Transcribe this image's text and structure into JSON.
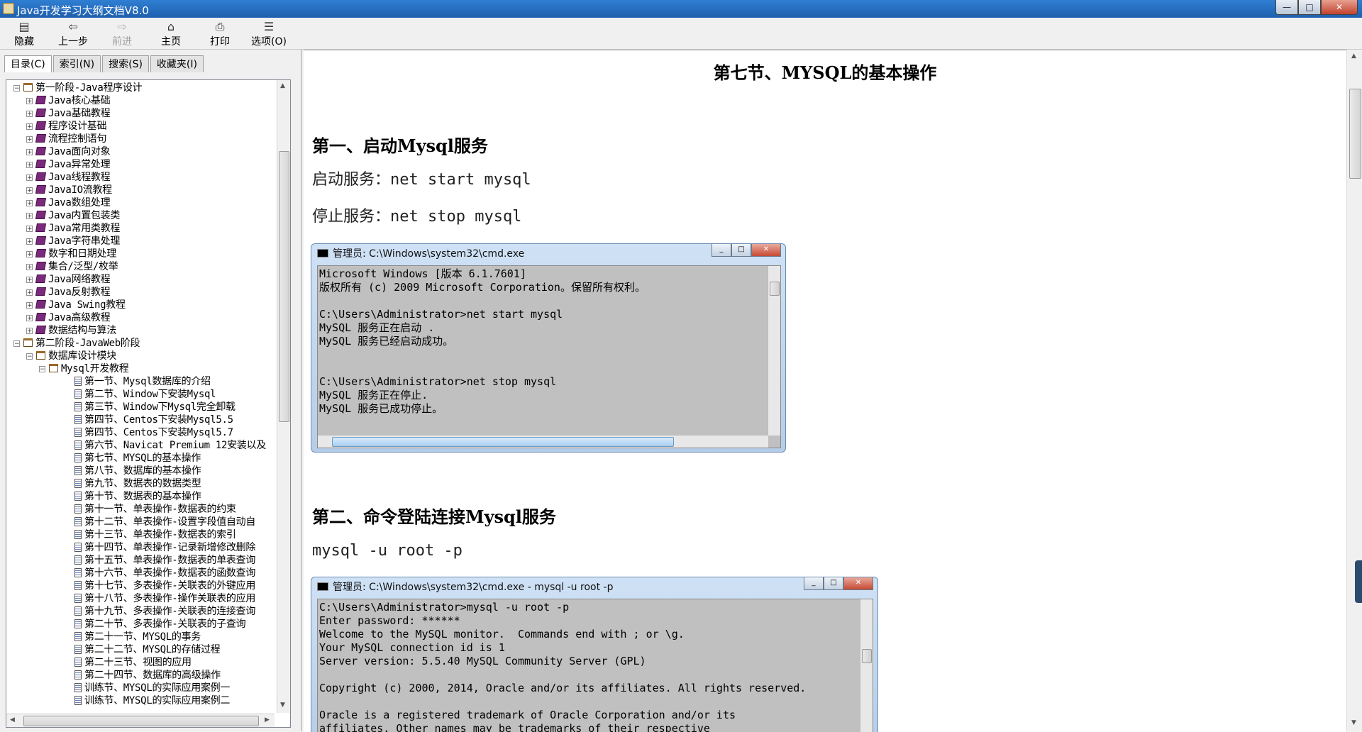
{
  "window": {
    "title": "Java开发学习大纲文档V8.0",
    "min": "—",
    "max": "□",
    "close": "✕"
  },
  "toolbar": [
    {
      "label": "隐藏",
      "icon": "hide-icon",
      "glyph": "▤"
    },
    {
      "label": "上一步",
      "icon": "back-icon",
      "glyph": "⇦"
    },
    {
      "label": "前进",
      "icon": "forward-icon",
      "glyph": "⇨"
    },
    {
      "label": "主页",
      "icon": "home-icon",
      "glyph": "⌂"
    },
    {
      "label": "打印",
      "icon": "print-icon",
      "glyph": "⎙"
    },
    {
      "label": "选项(O)",
      "icon": "options-icon",
      "glyph": "☰"
    }
  ],
  "tabs": [
    "目录(C)",
    "索引(N)",
    "搜索(S)",
    "收藏夹(I)"
  ],
  "tree": [
    {
      "level": 0,
      "type": "book-open",
      "exp": "−",
      "label": "第一阶段-Java程序设计"
    },
    {
      "level": 1,
      "type": "book",
      "exp": "+",
      "label": "Java核心基础"
    },
    {
      "level": 1,
      "type": "book",
      "exp": "+",
      "label": "Java基础教程"
    },
    {
      "level": 1,
      "type": "book",
      "exp": "+",
      "label": "程序设计基础"
    },
    {
      "level": 1,
      "type": "book",
      "exp": "+",
      "label": "流程控制语句"
    },
    {
      "level": 1,
      "type": "book",
      "exp": "+",
      "label": "Java面向对象"
    },
    {
      "level": 1,
      "type": "book",
      "exp": "+",
      "label": "Java异常处理"
    },
    {
      "level": 1,
      "type": "book",
      "exp": "+",
      "label": "Java线程教程"
    },
    {
      "level": 1,
      "type": "book",
      "exp": "+",
      "label": "JavaIO流教程"
    },
    {
      "level": 1,
      "type": "book",
      "exp": "+",
      "label": "Java数组处理"
    },
    {
      "level": 1,
      "type": "book",
      "exp": "+",
      "label": "Java内置包装类"
    },
    {
      "level": 1,
      "type": "book",
      "exp": "+",
      "label": "Java常用类教程"
    },
    {
      "level": 1,
      "type": "book",
      "exp": "+",
      "label": "Java字符串处理"
    },
    {
      "level": 1,
      "type": "book",
      "exp": "+",
      "label": "数字和日期处理"
    },
    {
      "level": 1,
      "type": "book",
      "exp": "+",
      "label": "集合/泛型/枚举"
    },
    {
      "level": 1,
      "type": "book",
      "exp": "+",
      "label": "Java网络教程"
    },
    {
      "level": 1,
      "type": "book",
      "exp": "+",
      "label": "Java反射教程"
    },
    {
      "level": 1,
      "type": "book",
      "exp": "+",
      "label": "Java Swing教程"
    },
    {
      "level": 1,
      "type": "book",
      "exp": "+",
      "label": "Java高级教程"
    },
    {
      "level": 1,
      "type": "book",
      "exp": "+",
      "label": "数据结构与算法"
    },
    {
      "level": 0,
      "type": "book-open",
      "exp": "−",
      "label": "第二阶段-JavaWeb阶段"
    },
    {
      "level": 1,
      "type": "book-open",
      "exp": "−",
      "label": "数据库设计模块"
    },
    {
      "level": 2,
      "type": "book-open",
      "exp": "−",
      "label": "Mysql开发教程"
    },
    {
      "level": 3,
      "type": "page",
      "label": "第一节、Mysql数据库的介绍"
    },
    {
      "level": 3,
      "type": "page",
      "label": "第二节、Window下安装Mysql"
    },
    {
      "level": 3,
      "type": "page",
      "label": "第三节、Window下Mysql完全卸载"
    },
    {
      "level": 3,
      "type": "page",
      "label": "第四节、Centos下安装Mysql5.5"
    },
    {
      "level": 3,
      "type": "page",
      "label": "第四节、Centos下安装Mysql5.7"
    },
    {
      "level": 3,
      "type": "page",
      "label": "第六节、Navicat Premium 12安装以及"
    },
    {
      "level": 3,
      "type": "page",
      "label": "第七节、MYSQL的基本操作"
    },
    {
      "level": 3,
      "type": "page",
      "label": "第八节、数据库的基本操作"
    },
    {
      "level": 3,
      "type": "page",
      "label": "第九节、数据表的数据类型"
    },
    {
      "level": 3,
      "type": "page",
      "label": "第十节、数据表的基本操作"
    },
    {
      "level": 3,
      "type": "page",
      "label": "第十一节、单表操作-数据表的约束"
    },
    {
      "level": 3,
      "type": "page",
      "label": "第十二节、单表操作-设置字段值自动自"
    },
    {
      "level": 3,
      "type": "page",
      "label": "第十三节、单表操作-数据表的索引"
    },
    {
      "level": 3,
      "type": "page",
      "label": "第十四节、单表操作-记录新增修改删除"
    },
    {
      "level": 3,
      "type": "page",
      "label": "第十五节、单表操作-数据表的单表查询"
    },
    {
      "level": 3,
      "type": "page",
      "label": "第十六节、单表操作-数据表的函数查询"
    },
    {
      "level": 3,
      "type": "page",
      "label": "第十七节、多表操作-关联表的外键应用"
    },
    {
      "level": 3,
      "type": "page",
      "label": "第十八节、多表操作-操作关联表的应用"
    },
    {
      "level": 3,
      "type": "page",
      "label": "第十九节、多表操作-关联表的连接查询"
    },
    {
      "level": 3,
      "type": "page",
      "label": "第二十节、多表操作-关联表的子查询"
    },
    {
      "level": 3,
      "type": "page",
      "label": "第二十一节、MYSQL的事务"
    },
    {
      "level": 3,
      "type": "page",
      "label": "第二十二节、MYSQL的存储过程"
    },
    {
      "level": 3,
      "type": "page",
      "label": "第二十三节、视图的应用"
    },
    {
      "level": 3,
      "type": "page",
      "label": "第二十四节、数据库的高级操作"
    },
    {
      "level": 3,
      "type": "page",
      "label": "训练节、MYSQL的实际应用案例一"
    },
    {
      "level": 3,
      "type": "page",
      "label": "训练节、MYSQL的实际应用案例二"
    }
  ],
  "content": {
    "title": "第七节、MYSQL的基本操作",
    "h1": "第一、启动Mysql服务",
    "p1": "启动服务：net start mysql",
    "p2": "停止服务：net stop mysql",
    "cmd1": {
      "title": "管理员: C:\\Windows\\system32\\cmd.exe",
      "text": "Microsoft Windows [版本 6.1.7601]\n版权所有 (c) 2009 Microsoft Corporation。保留所有权利。\n\nC:\\Users\\Administrator>net start mysql\nMySQL 服务正在启动 .\nMySQL 服务已经启动成功。\n\n\nC:\\Users\\Administrator>net stop mysql\nMySQL 服务正在停止.\nMySQL 服务已成功停止。"
    },
    "h2": "第二、命令登陆连接Mysql服务",
    "p3": "mysql -u root -p",
    "cmd2": {
      "title": "管理员: C:\\Windows\\system32\\cmd.exe - mysql  -u root -p",
      "text": "C:\\Users\\Administrator>mysql -u root -p\nEnter password: ******\nWelcome to the MySQL monitor.  Commands end with ; or \\g.\nYour MySQL connection id is 1\nServer version: 5.5.40 MySQL Community Server (GPL)\n\nCopyright (c) 2000, 2014, Oracle and/or its affiliates. All rights reserved.\n\nOracle is a registered trademark of Oracle Corporation and/or its\naffiliates. Other names may be trademarks of their respective"
    }
  }
}
